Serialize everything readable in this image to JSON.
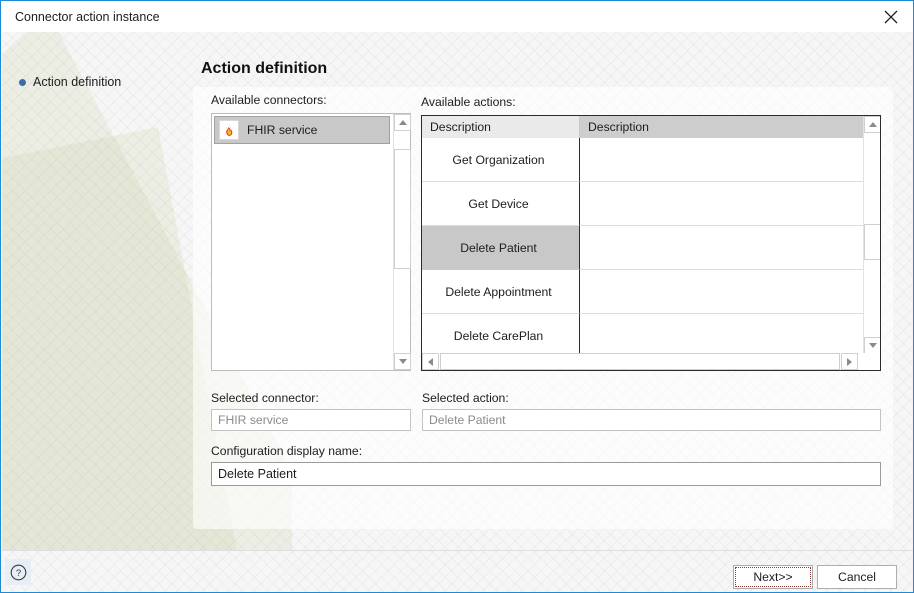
{
  "window": {
    "title": "Connector action instance",
    "close_icon": "close-icon",
    "border_color": "#1e8ad6"
  },
  "nav": {
    "items": [
      {
        "label": "Action definition",
        "selected": true
      }
    ]
  },
  "main": {
    "page_title": "Action definition",
    "connectors": {
      "label": "Available connectors:",
      "items": [
        {
          "label": "FHIR service",
          "icon": "flame-icon",
          "selected": true
        }
      ]
    },
    "actions": {
      "label": "Available actions:",
      "columns": [
        "Description",
        "Description"
      ],
      "rows": [
        {
          "description": "Get Organization",
          "detail": "",
          "selected": false
        },
        {
          "description": "Get Device",
          "detail": "",
          "selected": false
        },
        {
          "description": "Delete Patient",
          "detail": "",
          "selected": true
        },
        {
          "description": "Delete Appointment",
          "detail": "",
          "selected": false
        },
        {
          "description": "Delete CarePlan",
          "detail": "",
          "selected": false
        }
      ]
    },
    "selected_connector": {
      "label": "Selected connector:",
      "value": "FHIR service"
    },
    "selected_action": {
      "label": "Selected action:",
      "value": "Delete Patient"
    },
    "configuration_display_name": {
      "label": "Configuration display name:",
      "value": "Delete Patient"
    }
  },
  "footer": {
    "help_icon": "help-circle-icon",
    "next_label": "Next>>",
    "cancel_label": "Cancel"
  }
}
